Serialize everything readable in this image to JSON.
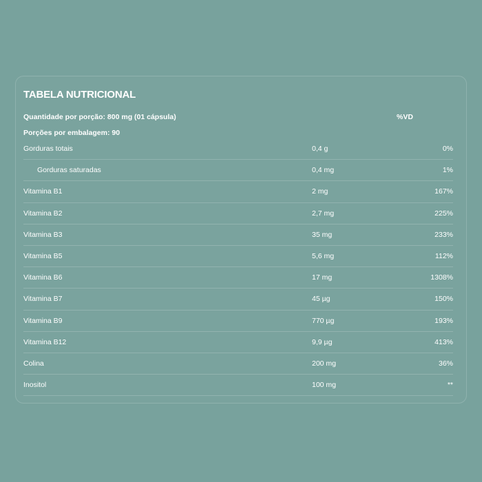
{
  "table": {
    "title": "TABELA NUTRICIONAL",
    "serving": "Quantidade por porção: 800 mg (01 cápsula)",
    "servings_per_package": "Porções por embalagem: 90",
    "vd_header": "%VD",
    "rows": [
      {
        "name": "Gorduras totais",
        "amount": "0,4 g",
        "vd": "0%"
      },
      {
        "name": "Gorduras saturadas",
        "amount": "0,4 mg",
        "vd": "1%"
      },
      {
        "name": "Vitamina B1",
        "amount": "2 mg",
        "vd": "167%"
      },
      {
        "name": "Vitamina B2",
        "amount": "2,7 mg",
        "vd": "225%"
      },
      {
        "name": "Vitamina B3",
        "amount": "35 mg",
        "vd": "233%"
      },
      {
        "name": "Vitamina B5",
        "amount": "5,6 mg",
        "vd": "112%"
      },
      {
        "name": "Vitamina B6",
        "amount": "17 mg",
        "vd": "1308%"
      },
      {
        "name": "Vitamina B7",
        "amount": "45 µg",
        "vd": "150%"
      },
      {
        "name": "Vitamina B9",
        "amount": "770 µg",
        "vd": "193%"
      },
      {
        "name": "Vitamina B12",
        "amount": "9,9 µg",
        "vd": "413%"
      },
      {
        "name": "Colina",
        "amount": "200 mg",
        "vd": "36%"
      },
      {
        "name": "Inositol",
        "amount": "100 mg",
        "vd": "**"
      }
    ]
  },
  "colors": {
    "background": "#78a29d",
    "text": "#ffffff"
  }
}
